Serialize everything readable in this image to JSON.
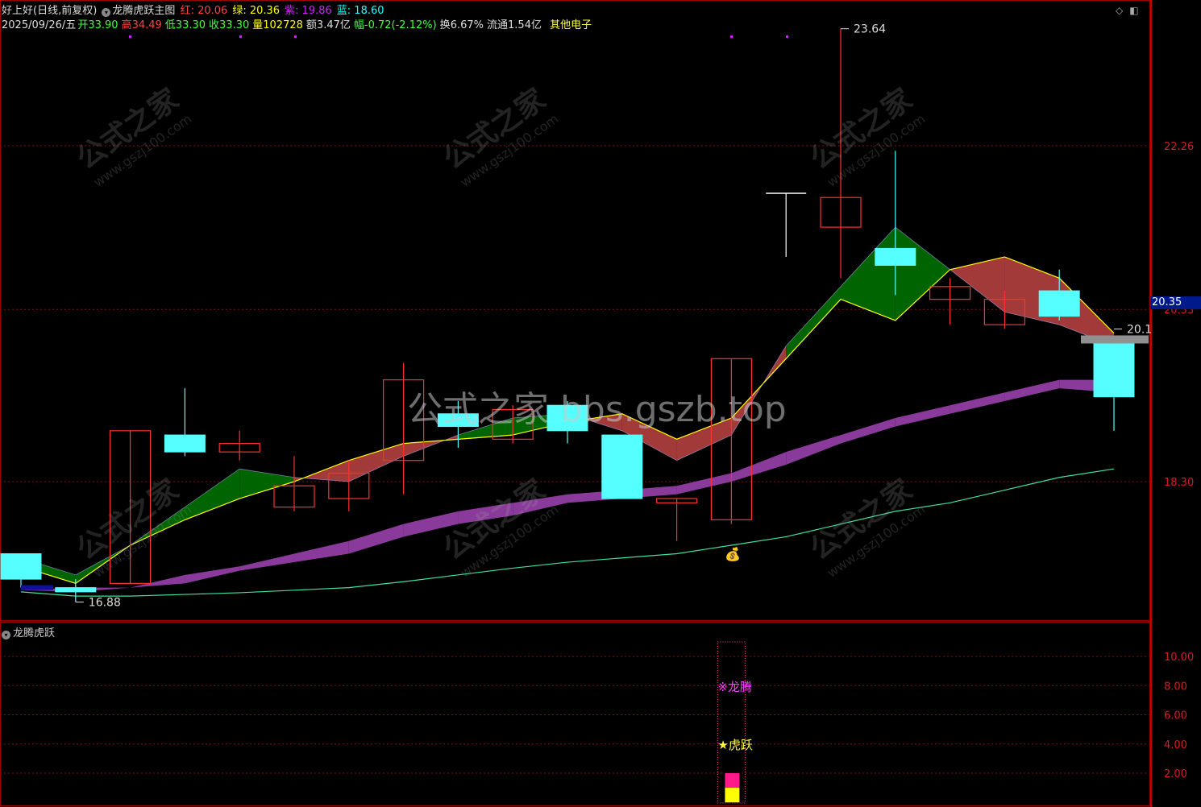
{
  "header": {
    "stock_name": "好上好(日线,前复权)",
    "indicator_name": "龙腾虎跃主图",
    "indicator_values": [
      {
        "label": "红:",
        "value": "20.06",
        "color": "#ff4040"
      },
      {
        "label": "绿:",
        "value": "20.36",
        "color": "#ffff00"
      },
      {
        "label": "紫:",
        "value": "19.86",
        "color": "#d020ff"
      },
      {
        "label": "蓝:",
        "value": "18.60",
        "color": "#20ffff"
      }
    ],
    "date": "2025/09/26/五",
    "quote": [
      {
        "label": "开",
        "value": "33.90",
        "color": "#40ff40"
      },
      {
        "label": "高",
        "value": "34.49",
        "color": "#ff4040"
      },
      {
        "label": "低",
        "value": "33.30",
        "color": "#40ff40"
      },
      {
        "label": "收",
        "value": "33.30",
        "color": "#40ff40"
      },
      {
        "label": "量",
        "value": "102728",
        "color": "#ffff00"
      },
      {
        "label": "额",
        "value": "3.47亿",
        "color": "#dddddd"
      },
      {
        "label": "幅",
        "value": "-0.72(-2.12%)",
        "color": "#40ff40"
      },
      {
        "label": "换",
        "value": "6.67%",
        "color": "#dddddd"
      },
      {
        "label": "流通",
        "value": "1.54亿",
        "color": "#dddddd"
      }
    ],
    "sector": "其他电子"
  },
  "watermark": {
    "center": "公式之家 bbs.gszb.top",
    "diag_main": "公式之家",
    "diag_url": "www.gszj100.com"
  },
  "current_price": "20.35",
  "subchart": {
    "title": "龙腾虎跃",
    "signal1": "※龙腾",
    "signal2": "★虎跃"
  },
  "chart_data": [
    {
      "type": "candlestick",
      "title": "",
      "yaxis_ticks": [
        "22.26",
        "20.33",
        "18.30"
      ],
      "ylim": [
        16.5,
        24.0
      ],
      "annotations": [
        {
          "text": "23.64",
          "x_index": 15,
          "value": 23.64
        },
        {
          "text": "16.88",
          "x_index": 1,
          "value": 16.88
        },
        {
          "text": "20.1",
          "x_index": 20,
          "value": 20.1
        }
      ],
      "candles": [
        {
          "open": 17.15,
          "high": 17.4,
          "low": 17.05,
          "close": 17.45,
          "color": "cyan"
        },
        {
          "open": 17.0,
          "high": 17.15,
          "low": 16.88,
          "close": 17.05,
          "color": "cyan"
        },
        {
          "open": 17.1,
          "high": 18.9,
          "low": 17.1,
          "close": 18.9,
          "color": "red"
        },
        {
          "open": 18.65,
          "high": 19.4,
          "low": 18.6,
          "close": 18.85,
          "color": "cyan"
        },
        {
          "open": 18.65,
          "high": 18.9,
          "low": 18.55,
          "close": 18.75,
          "color": "red"
        },
        {
          "open": 18.0,
          "high": 18.6,
          "low": 17.95,
          "close": 18.25,
          "color": "red"
        },
        {
          "open": 18.1,
          "high": 18.55,
          "low": 17.95,
          "close": 18.4,
          "color": "red"
        },
        {
          "open": 18.55,
          "high": 19.7,
          "low": 18.15,
          "close": 19.5,
          "color": "red"
        },
        {
          "open": 18.95,
          "high": 19.25,
          "low": 18.7,
          "close": 19.1,
          "color": "cyan"
        },
        {
          "open": 18.8,
          "high": 19.2,
          "low": 18.75,
          "close": 19.15,
          "color": "red"
        },
        {
          "open": 18.9,
          "high": 19.25,
          "low": 18.75,
          "close": 19.2,
          "color": "cyan"
        },
        {
          "open": 18.1,
          "high": 18.85,
          "low": 18.1,
          "close": 18.85,
          "color": "cyan"
        },
        {
          "open": 18.05,
          "high": 18.1,
          "low": 17.6,
          "close": 18.1,
          "color": "red"
        },
        {
          "open": 17.85,
          "high": 19.75,
          "low": 17.8,
          "close": 19.75,
          "color": "red"
        },
        {
          "open": 21.7,
          "high": 21.7,
          "low": 20.95,
          "close": 21.7,
          "color": "white"
        },
        {
          "open": 21.3,
          "high": 23.64,
          "low": 20.7,
          "close": 21.65,
          "color": "red"
        },
        {
          "open": 20.85,
          "high": 22.2,
          "low": 20.5,
          "close": 21.05,
          "color": "cyan"
        },
        {
          "open": 20.45,
          "high": 20.7,
          "low": 20.15,
          "close": 20.6,
          "color": "red"
        },
        {
          "open": 20.15,
          "high": 20.55,
          "low": 20.1,
          "close": 20.45,
          "color": "red"
        },
        {
          "open": 20.25,
          "high": 20.8,
          "low": 20.2,
          "close": 20.55,
          "color": "cyan"
        },
        {
          "open": 19.3,
          "high": 20.0,
          "low": 18.9,
          "close": 20.0,
          "color": "cyan"
        }
      ],
      "series": [
        {
          "values": [
            17.4,
            17.2,
            17.55,
            18.0,
            18.45,
            18.35,
            18.3,
            18.6,
            18.85,
            19.05,
            19.1,
            18.9,
            18.55,
            18.85,
            19.9,
            20.6,
            21.3,
            20.8,
            20.3,
            20.15,
            19.9
          ]
        },
        {
          "values": [
            17.3,
            17.1,
            17.55,
            17.85,
            18.1,
            18.3,
            18.55,
            18.75,
            18.8,
            18.85,
            19.0,
            19.1,
            18.8,
            19.05,
            19.75,
            20.45,
            20.2,
            20.8,
            20.95,
            20.7,
            20.05
          ]
        },
        {
          "values": [
            17.02,
            17.05,
            17.05,
            17.2,
            17.3,
            17.45,
            17.6,
            17.8,
            17.95,
            18.05,
            18.15,
            18.2,
            18.25,
            18.4,
            18.65,
            18.85,
            19.05,
            19.2,
            19.35,
            19.5,
            19.5
          ]
        },
        {
          "values": [
            17.02,
            17.0,
            17.05,
            17.1,
            17.25,
            17.35,
            17.45,
            17.65,
            17.8,
            17.9,
            18.05,
            18.1,
            18.15,
            18.3,
            18.5,
            18.75,
            18.95,
            19.1,
            19.25,
            19.4,
            19.35
          ]
        },
        {
          "values": [
            17.0,
            16.95,
            16.95,
            16.97,
            16.99,
            17.02,
            17.05,
            17.12,
            17.2,
            17.28,
            17.35,
            17.4,
            17.45,
            17.55,
            17.65,
            17.8,
            17.95,
            18.05,
            18.2,
            18.35,
            18.45
          ]
        }
      ]
    },
    {
      "type": "bar",
      "title": "",
      "yaxis_ticks": [
        "10.00",
        "8.00",
        "6.00",
        "4.00",
        "2.00"
      ],
      "ylim": [
        0,
        11
      ],
      "signal_index": 13,
      "bars": [
        {
          "value": 2.0,
          "color": "#ff1a8c"
        },
        {
          "value": 1.0,
          "color": "#ffff00"
        }
      ]
    }
  ]
}
